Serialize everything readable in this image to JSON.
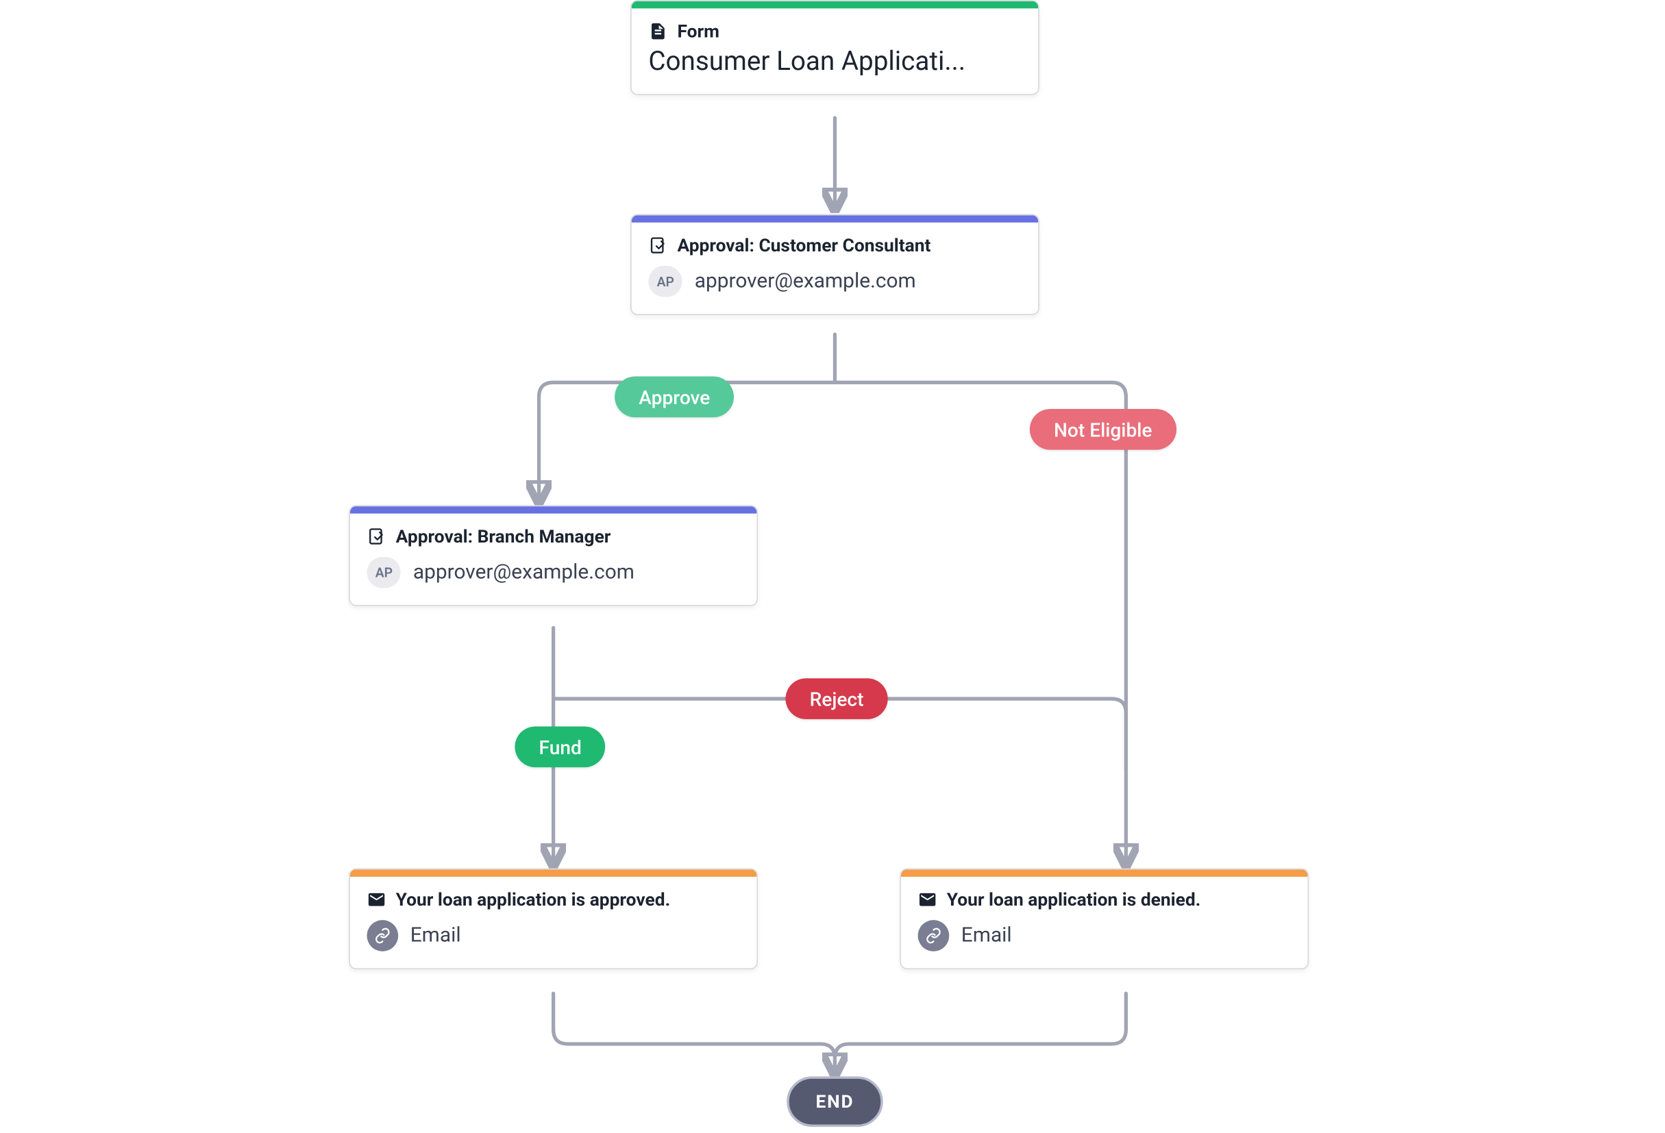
{
  "nodes": {
    "form": {
      "type_label": "Form",
      "title": "Consumer Loan Applicati..."
    },
    "approval1": {
      "title": "Approval: Customer Consultant",
      "approver_chip": "AP",
      "approver_email": "approver@example.com"
    },
    "approval2": {
      "title": "Approval: Branch Manager",
      "approver_chip": "AP",
      "approver_email": "approver@example.com"
    },
    "email_approved": {
      "title": "Your loan application is approved.",
      "channel": "Email"
    },
    "email_denied": {
      "title": "Your loan application is denied.",
      "channel": "Email"
    }
  },
  "pills": {
    "approve": "Approve",
    "not_eligible": "Not Eligible",
    "fund": "Fund",
    "reject": "Reject"
  },
  "end_label": "END"
}
